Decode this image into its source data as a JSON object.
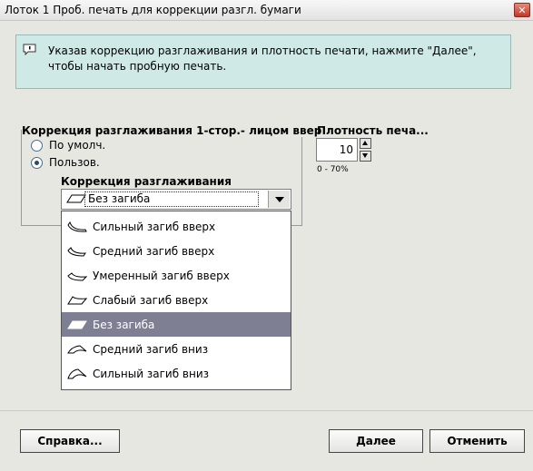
{
  "window": {
    "title": "Лоток 1 Проб. печать для коррекции разгл. бумаги",
    "close_label": "✕"
  },
  "info": {
    "text_line1": "Указав коррекцию разглаживания и плотность печати, нажмите \"Далее\",",
    "text_line2": "чтобы начать пробную печать."
  },
  "correction_group": {
    "title": "Коррекция разглаживания 1-стор.- лицом ввер",
    "options": [
      {
        "label": "По умолч.",
        "checked": false
      },
      {
        "label": "Пользов.",
        "checked": true
      }
    ],
    "combo_label": "Коррекция разглаживания",
    "combo_value": "Без загиба"
  },
  "dropdown_items": [
    {
      "label": "Сильный загиб вверх",
      "icon": "curl-up-strong-icon",
      "selected": false
    },
    {
      "label": "Средний загиб вверх",
      "icon": "curl-up-medium-icon",
      "selected": false
    },
    {
      "label": "Умеренный загиб вверх",
      "icon": "curl-up-moderate-icon",
      "selected": false
    },
    {
      "label": "Слабый загиб вверх",
      "icon": "curl-up-weak-icon",
      "selected": false
    },
    {
      "label": "Без загиба",
      "icon": "flat-sheet-icon",
      "selected": true
    },
    {
      "label": "Средний загиб вниз",
      "icon": "curl-down-medium-icon",
      "selected": false
    },
    {
      "label": "Сильный загиб вниз",
      "icon": "curl-down-strong-icon",
      "selected": false
    }
  ],
  "density": {
    "title": "Плотность печа...",
    "value": "10",
    "range": "0 - 70%"
  },
  "buttons": {
    "help": "Справка...",
    "next": "Далее",
    "cancel": "Отменить"
  }
}
